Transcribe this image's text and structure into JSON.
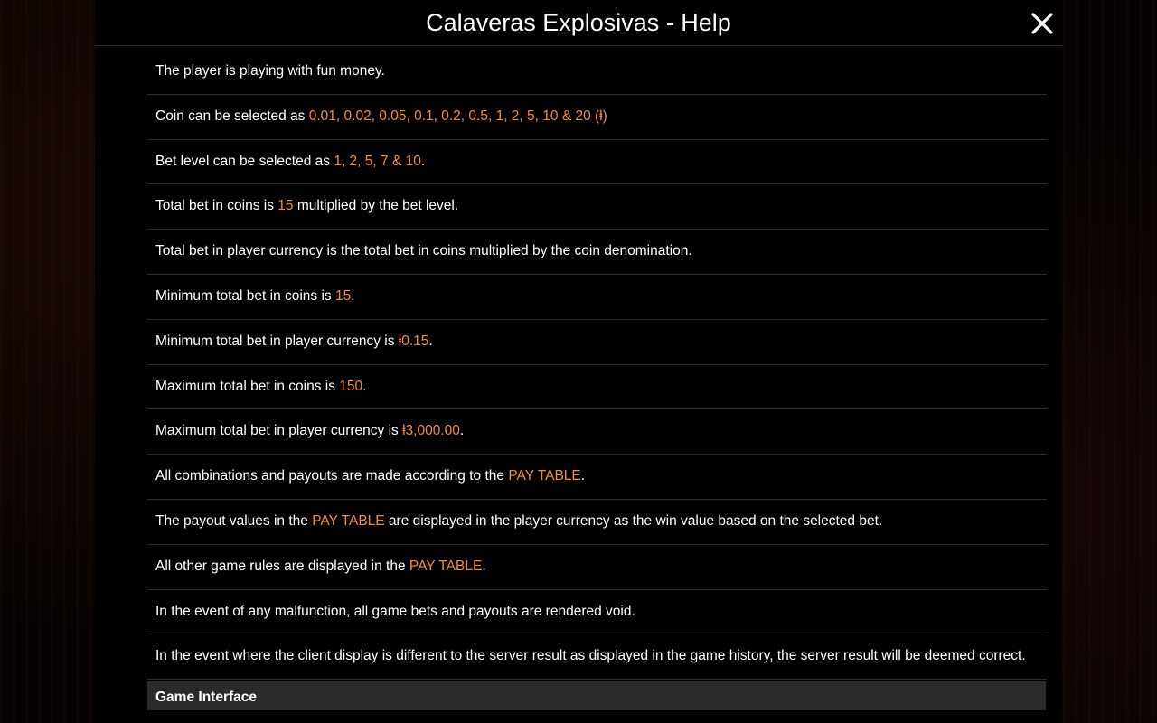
{
  "header": {
    "title": "Calaveras Explosivas - Help"
  },
  "icons": {
    "close": "close-icon"
  },
  "colors": {
    "highlight": "#f08c3c",
    "text": "#ffffff",
    "divider": "#2a2a2a",
    "section_bg": "#2a2a2a"
  },
  "rules": [
    {
      "parts": [
        {
          "t": "The player is playing with fun money."
        }
      ]
    },
    {
      "parts": [
        {
          "t": "Coin can be selected as "
        },
        {
          "t": "0.01, 0.02, 0.05, 0.1, 0.2, 0.5, 1, 2, 5, 10 & 20 (ⱡ)",
          "hl": true
        }
      ]
    },
    {
      "parts": [
        {
          "t": "Bet level can be selected as "
        },
        {
          "t": "1, 2, 5, 7 & 10",
          "hl": true
        },
        {
          "t": "."
        }
      ]
    },
    {
      "parts": [
        {
          "t": "Total bet in coins is "
        },
        {
          "t": "15",
          "hl": true
        },
        {
          "t": " multiplied by the bet level."
        }
      ]
    },
    {
      "parts": [
        {
          "t": "Total bet in player currency is the total bet in coins multiplied by the coin denomination."
        }
      ]
    },
    {
      "parts": [
        {
          "t": "Minimum total bet in coins is "
        },
        {
          "t": "15",
          "hl": true
        },
        {
          "t": "."
        }
      ]
    },
    {
      "parts": [
        {
          "t": "Minimum total bet in player currency is "
        },
        {
          "t": "ⱡ0.15",
          "hl": true
        },
        {
          "t": "."
        }
      ]
    },
    {
      "parts": [
        {
          "t": "Maximum total bet in coins is "
        },
        {
          "t": "150",
          "hl": true
        },
        {
          "t": "."
        }
      ]
    },
    {
      "parts": [
        {
          "t": "Maximum total bet in player currency is "
        },
        {
          "t": "ⱡ3,000.00",
          "hl": true
        },
        {
          "t": "."
        }
      ]
    },
    {
      "parts": [
        {
          "t": "All combinations and payouts are made according to the "
        },
        {
          "t": "PAY TABLE",
          "hl": true
        },
        {
          "t": "."
        }
      ]
    },
    {
      "parts": [
        {
          "t": "The payout values in the "
        },
        {
          "t": "PAY TABLE",
          "hl": true
        },
        {
          "t": " are displayed in the player currency as the win value based on the selected bet."
        }
      ]
    },
    {
      "parts": [
        {
          "t": "All other game rules are displayed in the "
        },
        {
          "t": "PAY TABLE",
          "hl": true
        },
        {
          "t": "."
        }
      ]
    },
    {
      "parts": [
        {
          "t": "In the event of any malfunction, all game bets and payouts are rendered void."
        }
      ]
    },
    {
      "parts": [
        {
          "t": "In the event where the client display is different to the server result as displayed in the game history, the server result will be deemed correct."
        }
      ]
    }
  ],
  "section": {
    "title": "Game Interface"
  }
}
